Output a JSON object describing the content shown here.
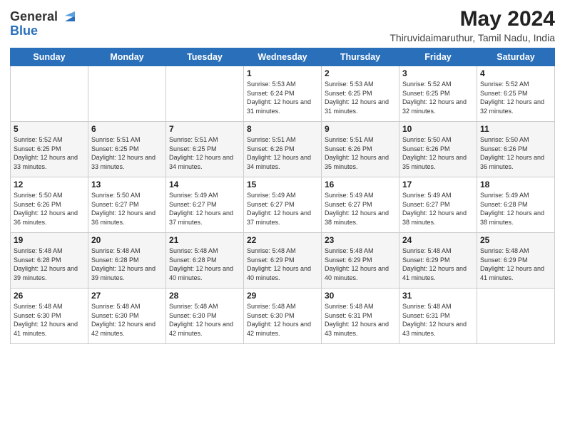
{
  "header": {
    "logo_general": "General",
    "logo_blue": "Blue",
    "month_year": "May 2024",
    "location": "Thiruvidaimaruthur, Tamil Nadu, India"
  },
  "days_of_week": [
    "Sunday",
    "Monday",
    "Tuesday",
    "Wednesday",
    "Thursday",
    "Friday",
    "Saturday"
  ],
  "weeks": [
    [
      {
        "day": "",
        "info": ""
      },
      {
        "day": "",
        "info": ""
      },
      {
        "day": "",
        "info": ""
      },
      {
        "day": "1",
        "info": "Sunrise: 5:53 AM\nSunset: 6:24 PM\nDaylight: 12 hours and 31 minutes."
      },
      {
        "day": "2",
        "info": "Sunrise: 5:53 AM\nSunset: 6:25 PM\nDaylight: 12 hours and 31 minutes."
      },
      {
        "day": "3",
        "info": "Sunrise: 5:52 AM\nSunset: 6:25 PM\nDaylight: 12 hours and 32 minutes."
      },
      {
        "day": "4",
        "info": "Sunrise: 5:52 AM\nSunset: 6:25 PM\nDaylight: 12 hours and 32 minutes."
      }
    ],
    [
      {
        "day": "5",
        "info": "Sunrise: 5:52 AM\nSunset: 6:25 PM\nDaylight: 12 hours and 33 minutes."
      },
      {
        "day": "6",
        "info": "Sunrise: 5:51 AM\nSunset: 6:25 PM\nDaylight: 12 hours and 33 minutes."
      },
      {
        "day": "7",
        "info": "Sunrise: 5:51 AM\nSunset: 6:25 PM\nDaylight: 12 hours and 34 minutes."
      },
      {
        "day": "8",
        "info": "Sunrise: 5:51 AM\nSunset: 6:26 PM\nDaylight: 12 hours and 34 minutes."
      },
      {
        "day": "9",
        "info": "Sunrise: 5:51 AM\nSunset: 6:26 PM\nDaylight: 12 hours and 35 minutes."
      },
      {
        "day": "10",
        "info": "Sunrise: 5:50 AM\nSunset: 6:26 PM\nDaylight: 12 hours and 35 minutes."
      },
      {
        "day": "11",
        "info": "Sunrise: 5:50 AM\nSunset: 6:26 PM\nDaylight: 12 hours and 36 minutes."
      }
    ],
    [
      {
        "day": "12",
        "info": "Sunrise: 5:50 AM\nSunset: 6:26 PM\nDaylight: 12 hours and 36 minutes."
      },
      {
        "day": "13",
        "info": "Sunrise: 5:50 AM\nSunset: 6:27 PM\nDaylight: 12 hours and 36 minutes."
      },
      {
        "day": "14",
        "info": "Sunrise: 5:49 AM\nSunset: 6:27 PM\nDaylight: 12 hours and 37 minutes."
      },
      {
        "day": "15",
        "info": "Sunrise: 5:49 AM\nSunset: 6:27 PM\nDaylight: 12 hours and 37 minutes."
      },
      {
        "day": "16",
        "info": "Sunrise: 5:49 AM\nSunset: 6:27 PM\nDaylight: 12 hours and 38 minutes."
      },
      {
        "day": "17",
        "info": "Sunrise: 5:49 AM\nSunset: 6:27 PM\nDaylight: 12 hours and 38 minutes."
      },
      {
        "day": "18",
        "info": "Sunrise: 5:49 AM\nSunset: 6:28 PM\nDaylight: 12 hours and 38 minutes."
      }
    ],
    [
      {
        "day": "19",
        "info": "Sunrise: 5:48 AM\nSunset: 6:28 PM\nDaylight: 12 hours and 39 minutes."
      },
      {
        "day": "20",
        "info": "Sunrise: 5:48 AM\nSunset: 6:28 PM\nDaylight: 12 hours and 39 minutes."
      },
      {
        "day": "21",
        "info": "Sunrise: 5:48 AM\nSunset: 6:28 PM\nDaylight: 12 hours and 40 minutes."
      },
      {
        "day": "22",
        "info": "Sunrise: 5:48 AM\nSunset: 6:29 PM\nDaylight: 12 hours and 40 minutes."
      },
      {
        "day": "23",
        "info": "Sunrise: 5:48 AM\nSunset: 6:29 PM\nDaylight: 12 hours and 40 minutes."
      },
      {
        "day": "24",
        "info": "Sunrise: 5:48 AM\nSunset: 6:29 PM\nDaylight: 12 hours and 41 minutes."
      },
      {
        "day": "25",
        "info": "Sunrise: 5:48 AM\nSunset: 6:29 PM\nDaylight: 12 hours and 41 minutes."
      }
    ],
    [
      {
        "day": "26",
        "info": "Sunrise: 5:48 AM\nSunset: 6:30 PM\nDaylight: 12 hours and 41 minutes."
      },
      {
        "day": "27",
        "info": "Sunrise: 5:48 AM\nSunset: 6:30 PM\nDaylight: 12 hours and 42 minutes."
      },
      {
        "day": "28",
        "info": "Sunrise: 5:48 AM\nSunset: 6:30 PM\nDaylight: 12 hours and 42 minutes."
      },
      {
        "day": "29",
        "info": "Sunrise: 5:48 AM\nSunset: 6:30 PM\nDaylight: 12 hours and 42 minutes."
      },
      {
        "day": "30",
        "info": "Sunrise: 5:48 AM\nSunset: 6:31 PM\nDaylight: 12 hours and 43 minutes."
      },
      {
        "day": "31",
        "info": "Sunrise: 5:48 AM\nSunset: 6:31 PM\nDaylight: 12 hours and 43 minutes."
      },
      {
        "day": "",
        "info": ""
      }
    ]
  ]
}
